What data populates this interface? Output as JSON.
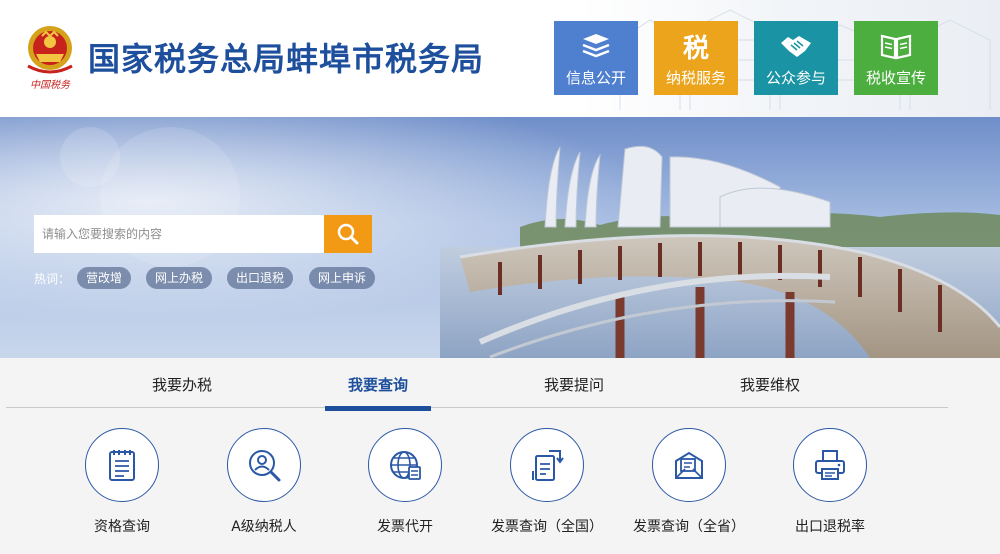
{
  "header": {
    "site_title": "国家税务总局蚌埠市税务局",
    "emblem_text": "中国税务",
    "nav": [
      {
        "label": "信息公开",
        "icon": "stack-icon",
        "color": "#4f7fcf"
      },
      {
        "label": "纳税服务",
        "icon": "tax-char-icon",
        "icon_text": "税",
        "color": "#eba41c"
      },
      {
        "label": "公众参与",
        "icon": "handshake-icon",
        "color": "#1a94a5"
      },
      {
        "label": "税收宣传",
        "icon": "book-icon",
        "color": "#4cae3f"
      }
    ]
  },
  "search": {
    "placeholder": "请输入您要搜索的内容",
    "button_icon": "search-icon"
  },
  "hot": {
    "label": "热词：",
    "tags": [
      "营改增",
      "网上办税",
      "出口退税",
      "网上申诉"
    ]
  },
  "tabs": [
    {
      "label": "我要办税",
      "active": false
    },
    {
      "label": "我要查询",
      "active": true
    },
    {
      "label": "我要提问",
      "active": false
    },
    {
      "label": "我要维权",
      "active": false
    }
  ],
  "query_items": [
    {
      "label": "资格查询",
      "icon": "document-list-icon"
    },
    {
      "label": "A级纳税人",
      "icon": "user-search-icon"
    },
    {
      "label": "发票代开",
      "icon": "globe-icon"
    },
    {
      "label": "发票查询（全国）",
      "icon": "invoice-exchange-icon"
    },
    {
      "label": "发票查询（全省）",
      "icon": "invoice-box-icon"
    },
    {
      "label": "出口退税率",
      "icon": "printer-icon"
    }
  ],
  "colors": {
    "brand_blue": "#1d4f9c",
    "search_orange": "#f29a14"
  }
}
